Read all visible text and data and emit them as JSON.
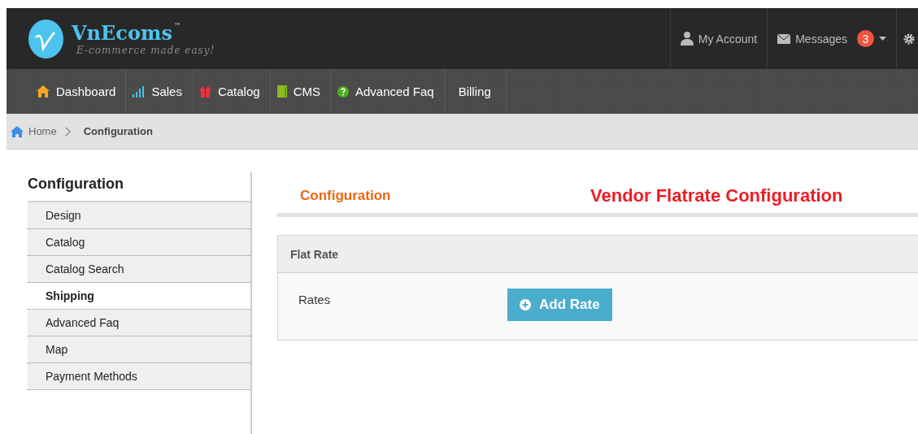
{
  "header": {
    "logo_name": "VnEcoms",
    "logo_mark": "™",
    "tagline": "E-commerce made easy!",
    "account": "My Account",
    "messages": "Messages",
    "message_count": "3"
  },
  "nav": [
    {
      "label": "Dashboard"
    },
    {
      "label": "Sales"
    },
    {
      "label": "Catalog"
    },
    {
      "label": "CMS"
    },
    {
      "label": "Advanced Faq"
    },
    {
      "label": "Billing"
    }
  ],
  "breadcrumb": {
    "home": "Home",
    "current": "Configuration"
  },
  "sidebar": {
    "title": "Configuration",
    "items": [
      {
        "label": "Design",
        "selected": false
      },
      {
        "label": "Catalog",
        "selected": false
      },
      {
        "label": "Catalog Search",
        "selected": false
      },
      {
        "label": "Shipping",
        "selected": true
      },
      {
        "label": "Advanced Faq",
        "selected": false
      },
      {
        "label": "Map",
        "selected": false
      },
      {
        "label": "Payment Methods",
        "selected": false
      }
    ]
  },
  "main": {
    "section_title": "Configuration",
    "page_title": "Vendor Flatrate Configuration",
    "panel": {
      "title": "Flat Rate",
      "row_label": "Rates",
      "button": "Add Rate"
    }
  }
}
